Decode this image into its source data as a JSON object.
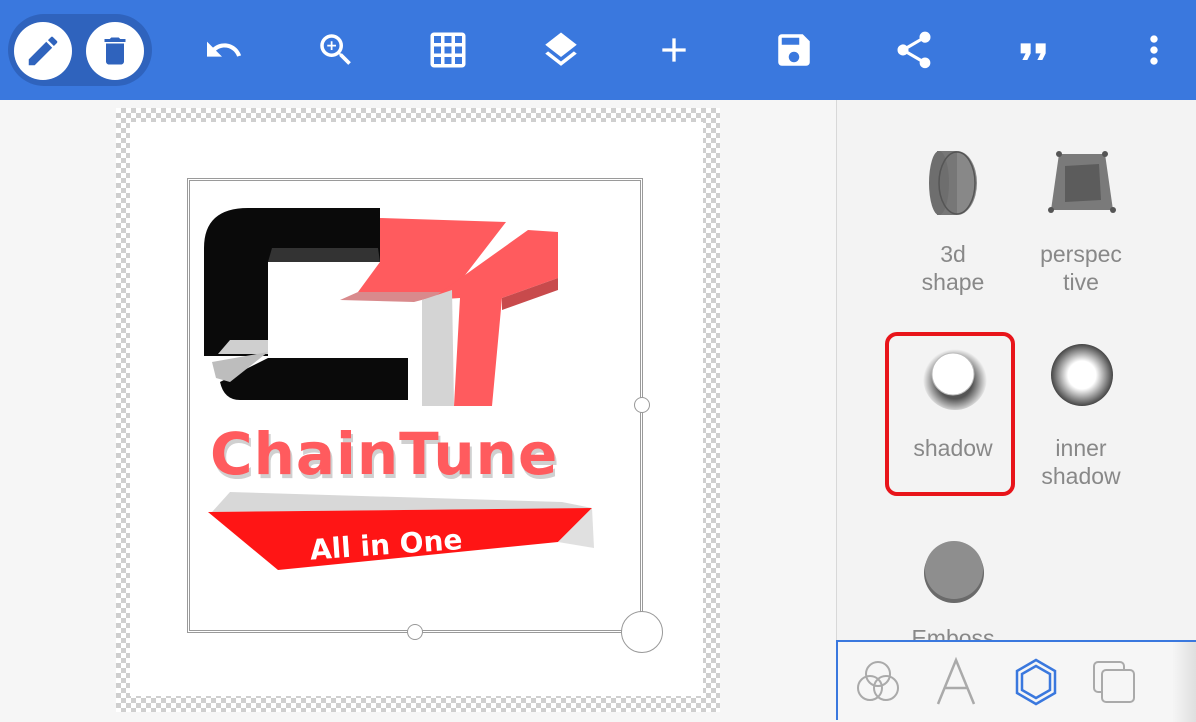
{
  "toolbar": {
    "mode_buttons": [
      {
        "name": "pencil-edit",
        "icon": "pencil-icon"
      },
      {
        "name": "delete",
        "icon": "trash-icon"
      }
    ],
    "actions": [
      {
        "name": "undo",
        "icon": "undo-icon"
      },
      {
        "name": "zoom",
        "icon": "zoom-in-icon"
      },
      {
        "name": "grid",
        "icon": "grid-icon"
      },
      {
        "name": "layers",
        "icon": "layers-icon"
      },
      {
        "name": "add",
        "icon": "plus-icon"
      },
      {
        "name": "save",
        "icon": "save-icon"
      },
      {
        "name": "share",
        "icon": "share-icon"
      },
      {
        "name": "quote",
        "icon": "quote-icon"
      },
      {
        "name": "more",
        "icon": "more-vert-icon"
      }
    ],
    "background_color": "#3a78de"
  },
  "canvas": {
    "logo": {
      "monogram": "CT",
      "brand_text": "ChainTune",
      "tagline": "All in One",
      "colors": {
        "black": "#0a0a0a",
        "red": "#ff5b5e",
        "banner": "#ff1515"
      }
    }
  },
  "effects_panel": {
    "items": [
      {
        "id": "3d-shape",
        "label": "3d\nshape",
        "icon": "3d-cylinder-icon"
      },
      {
        "id": "perspective",
        "label": "perspec\ntive",
        "icon": "perspective-trapezoid-icon"
      },
      {
        "id": "shadow",
        "label": "shadow",
        "icon": "shadow-circle-icon",
        "selected": true
      },
      {
        "id": "inner-shadow",
        "label": "inner\nshadow",
        "icon": "inner-shadow-circle-icon"
      },
      {
        "id": "emboss",
        "label": "Emboss",
        "icon": "emboss-circle-icon"
      }
    ],
    "highlight_color": "#e8141a"
  },
  "bottom_tabs": [
    {
      "name": "blend",
      "icon": "circles-overlap-icon"
    },
    {
      "name": "text",
      "icon": "letter-a-icon"
    },
    {
      "name": "shape-effects",
      "icon": "hexagon-icon",
      "active": true
    },
    {
      "name": "duplicate",
      "icon": "copy-layers-icon"
    }
  ]
}
